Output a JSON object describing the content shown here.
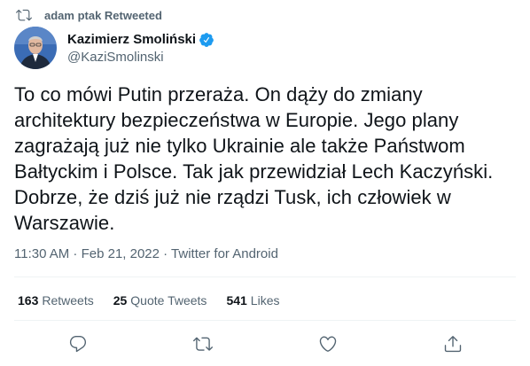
{
  "retweet": {
    "text": "adam ptak Retweeted",
    "icon": "retweet-icon"
  },
  "author": {
    "display_name": "Kazimierz Smoliński",
    "handle": "@KaziSmolinski",
    "verified": true,
    "verified_color": "#1d9bf0"
  },
  "tweet": {
    "text": "To co mówi Putin przeraża. On dąży do zmiany\narchitektury bezpieczeństwa w Europie. Jego plany\nzagrażają już nie tylko Ukrainie ale także Państwom\nBałtyckim i Polsce. Tak jak przewidział Lech Kaczyński.\nDobrze, że dziś już nie rządzi Tusk, ich człowiek w\nWarszawie.",
    "meta": "11:30 AM · Feb 21, 2022 · Twitter for Android"
  },
  "stats": {
    "retweets_count": "163",
    "retweets_label": "Retweets",
    "quotes_count": "25",
    "quotes_label": "Quote Tweets",
    "likes_count": "541",
    "likes_label": "Likes"
  },
  "actions": [
    "reply-icon",
    "retweet-icon",
    "like-icon",
    "share-icon"
  ],
  "colors": {
    "text": "#0f1419",
    "secondary": "#536471",
    "divider": "#eff3f4"
  }
}
